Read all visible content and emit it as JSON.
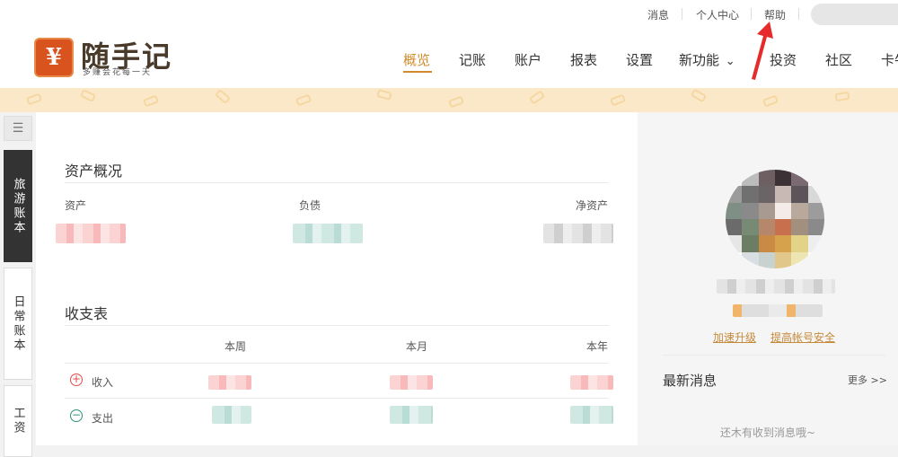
{
  "topbar": {
    "links": [
      "消息",
      "个人中心",
      "帮助"
    ]
  },
  "logo": {
    "symbol": "¥",
    "name": "随手记",
    "slogan": "多赚会花每一天"
  },
  "nav": {
    "items": [
      "概览",
      "记账",
      "账户",
      "报表",
      "设置",
      "新功能",
      "投资",
      "社区",
      "卡牛"
    ],
    "active": "概览",
    "dropdown_caret": "⌄"
  },
  "sidebar": {
    "menu_icon": "menu-icon",
    "tabs": [
      "旅游账本",
      "日常账本",
      "工资"
    ]
  },
  "assets": {
    "title": "资产概况",
    "labels": [
      "资产",
      "负债",
      "净资产"
    ]
  },
  "income_expense": {
    "title": "收支表",
    "columns": [
      "本周",
      "本月",
      "本年"
    ],
    "rows": [
      "收入",
      "支出"
    ]
  },
  "profile": {
    "links": [
      "加速升级",
      "提高帐号安全"
    ],
    "messages_title": "最新消息",
    "more": "更多 >>",
    "empty": "还木有收到消息哦~"
  },
  "colors": {
    "accent": "#d08a2c",
    "logo": "#d9531e",
    "income": "#e04a4a",
    "expense": "#2f8f7a"
  }
}
